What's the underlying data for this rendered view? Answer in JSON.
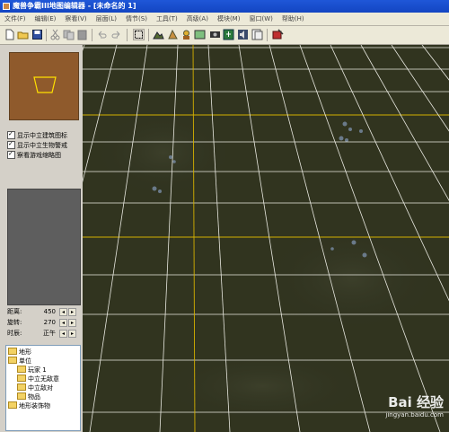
{
  "window": {
    "title": "魔兽争霸III地图编辑器 - [未命名的 1]"
  },
  "menu": [
    "文件(F)",
    "编辑(E)",
    "察看(V)",
    "层面(L)",
    "情节(S)",
    "工具(T)",
    "高级(A)",
    "模块(M)",
    "窗口(W)",
    "帮助(H)"
  ],
  "toolbar": {
    "icons": [
      "new-icon",
      "open-icon",
      "save-icon",
      "cut-icon",
      "copy-icon",
      "paste-icon",
      "undo-icon",
      "redo-icon",
      "select-icon",
      "terrain-tool-icon",
      "doodad-tool-icon",
      "unit-tool-icon",
      "region-tool-icon",
      "camera-tool-icon",
      "trigger-editor-icon",
      "sound-editor-icon",
      "object-editor-icon",
      "test-map-icon"
    ]
  },
  "left_panel": {
    "checkboxes": [
      {
        "label": "显示中立建筑图标",
        "checked": true
      },
      {
        "label": "显示中立生物警戒",
        "checked": true
      },
      {
        "label": "察看游戏缩略图",
        "checked": true
      }
    ],
    "params": [
      {
        "label": "距离:",
        "value": "450"
      },
      {
        "label": "旋转:",
        "value": "270"
      },
      {
        "label": "时辰:",
        "value": "正午"
      }
    ],
    "tree": [
      {
        "label": "地形",
        "indent": 0
      },
      {
        "label": "单位",
        "indent": 0
      },
      {
        "label": "玩家 1",
        "indent": 1
      },
      {
        "label": "中立无敌意",
        "indent": 1
      },
      {
        "label": "中立敌对",
        "indent": 1
      },
      {
        "label": "物品",
        "indent": 1
      },
      {
        "label": "地形装饰物",
        "indent": 0
      }
    ]
  },
  "watermark": {
    "brand": "Bai 经验",
    "url": "jingyan.baidu.com"
  },
  "colors": {
    "titlebar": "#1f57d8",
    "terrain": "#2e3120",
    "grid_minor": "#e8e8e0",
    "grid_major": "#d4b000"
  }
}
